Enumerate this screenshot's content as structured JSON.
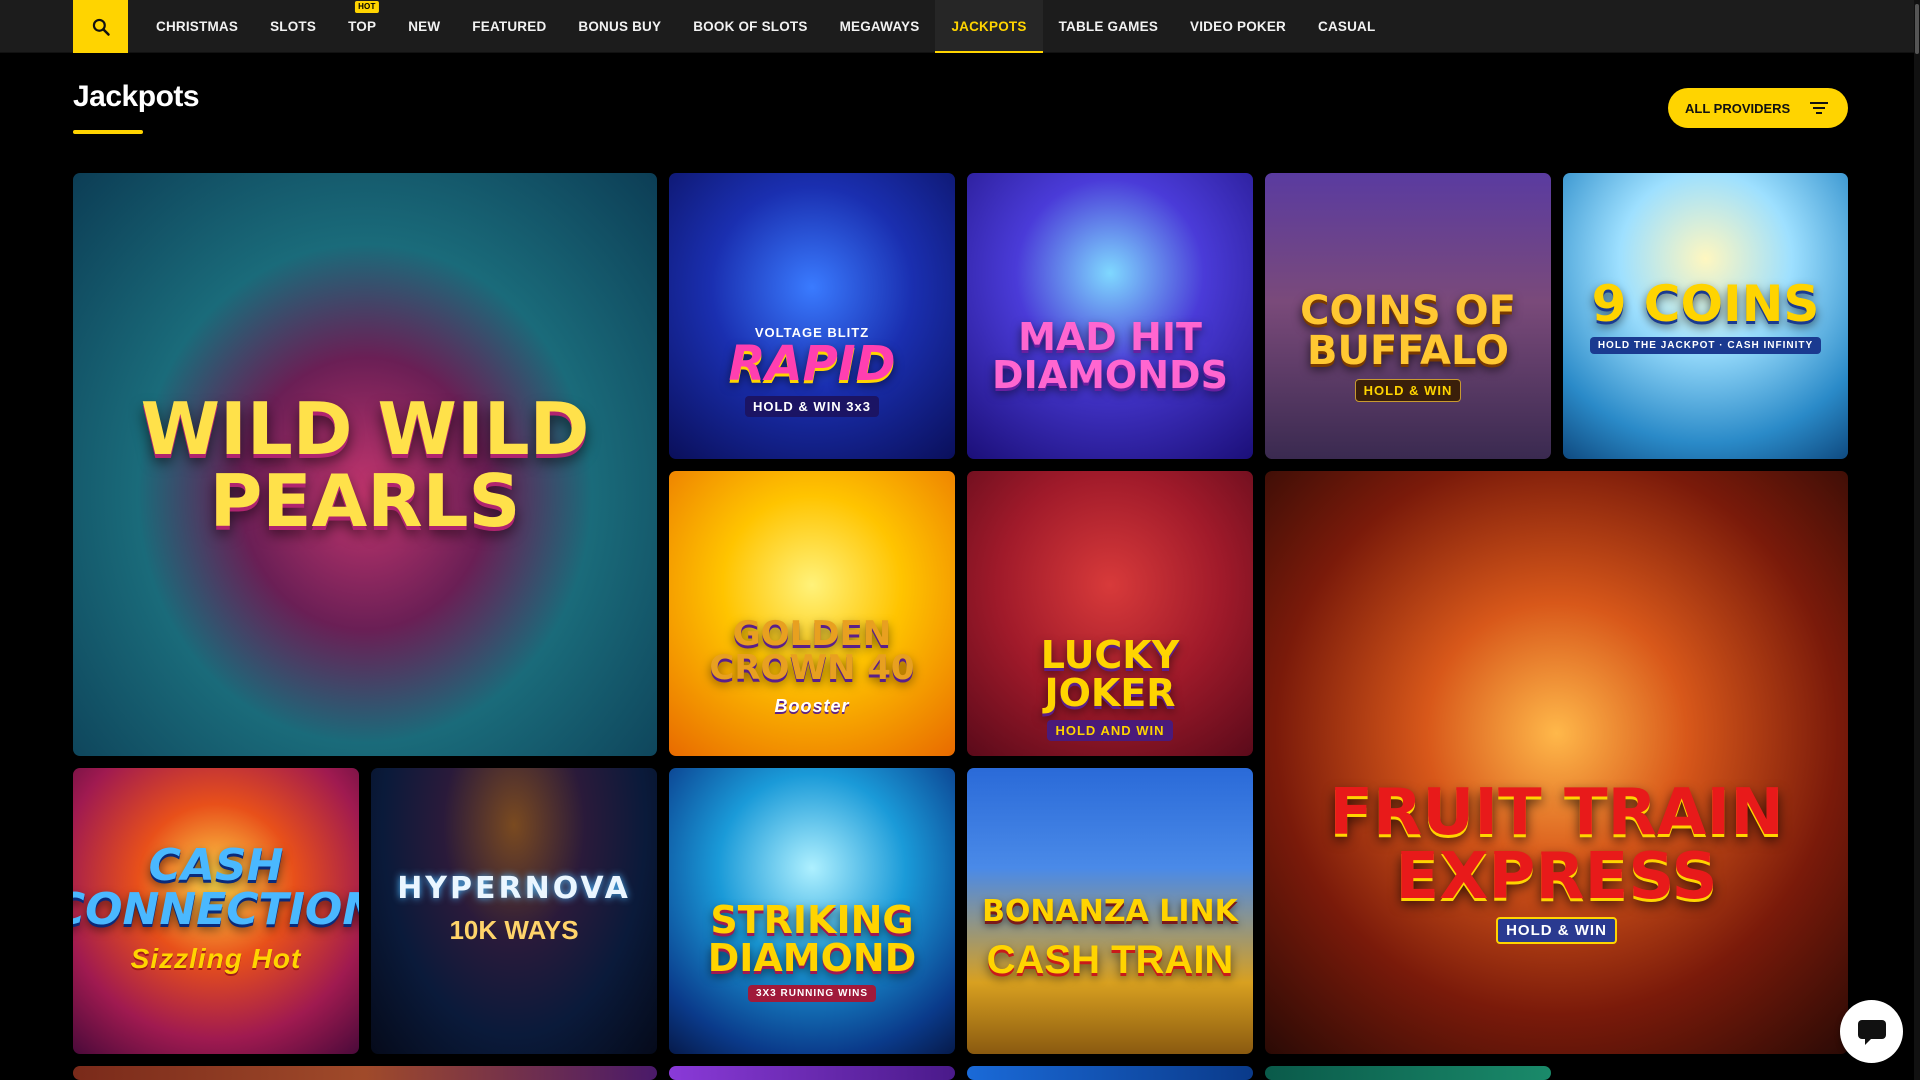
{
  "nav": {
    "items": [
      {
        "label": "CHRISTMAS",
        "active": false
      },
      {
        "label": "SLOTS",
        "active": false
      },
      {
        "label": "TOP",
        "active": false,
        "badge": "HOT"
      },
      {
        "label": "NEW",
        "active": false
      },
      {
        "label": "FEATURED",
        "active": false
      },
      {
        "label": "BONUS BUY",
        "active": false
      },
      {
        "label": "BOOK OF SLOTS",
        "active": false
      },
      {
        "label": "MEGAWAYS",
        "active": false
      },
      {
        "label": "JACKPOTS",
        "active": true
      },
      {
        "label": "TABLE GAMES",
        "active": false
      },
      {
        "label": "VIDEO POKER",
        "active": false
      },
      {
        "label": "CASUAL",
        "active": false
      }
    ]
  },
  "header": {
    "title": "Jackpots",
    "providers_label": "ALL PROVIDERS"
  },
  "games": [
    {
      "name": "Wild Wild Pearls"
    },
    {
      "name": "Rapid",
      "subtitle": "HOLD & WIN 3x3",
      "brand": "VOLTAGE BLITZ"
    },
    {
      "name": "Mad Hit Diamonds"
    },
    {
      "name": "Coins of Buffalo",
      "subtitle": "HOLD & WIN"
    },
    {
      "name": "9 Coins",
      "subtitle": "HOLD THE JACKPOT · CASH INFINITY"
    },
    {
      "name": "Golden Crown 40",
      "subtitle": "Booster"
    },
    {
      "name": "Lucky Joker",
      "subtitle": "HOLD AND WIN"
    },
    {
      "name": "Fruit Train Express",
      "subtitle": "HOLD & WIN"
    },
    {
      "name": "Cash Connection",
      "subtitle": "Sizzling Hot"
    },
    {
      "name": "Hypernova",
      "subtitle": "10K WAYS"
    },
    {
      "name": "Striking Diamond",
      "subtitle": "3X3 RUNNING WINS"
    },
    {
      "name": "Bonanza Link",
      "subtitle": "CASH TRAIN"
    }
  ],
  "colors": {
    "accent": "#ffd400",
    "nav_bg": "#1c1c1c",
    "page_bg": "#000000"
  },
  "icons": {
    "search": "search-icon",
    "filter": "filter-icon",
    "chat": "chat-icon"
  }
}
